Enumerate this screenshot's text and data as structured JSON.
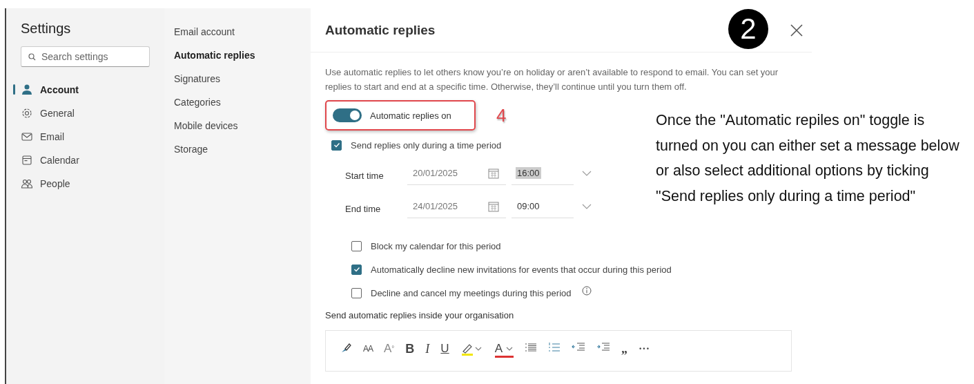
{
  "settings": {
    "title": "Settings",
    "search": {
      "placeholder": "Search settings"
    },
    "nav": [
      {
        "label": "Account",
        "selected": true
      },
      {
        "label": "General",
        "selected": false
      },
      {
        "label": "Email",
        "selected": false
      },
      {
        "label": "Calendar",
        "selected": false
      },
      {
        "label": "People",
        "selected": false
      }
    ]
  },
  "submenu": [
    {
      "label": "Email account",
      "selected": false
    },
    {
      "label": "Automatic replies",
      "selected": true
    },
    {
      "label": "Signatures",
      "selected": false
    },
    {
      "label": "Categories",
      "selected": false
    },
    {
      "label": "Mobile devices",
      "selected": false
    },
    {
      "label": "Storage",
      "selected": false
    }
  ],
  "panel": {
    "title": "Automatic replies",
    "step_badge": "2",
    "description": "Use automatic replies to let others know you’re on holiday or aren’t available to respond to email. You can set your replies to start and end at a specific time. Otherwise, they’ll continue until you turn them off.",
    "toggle": {
      "label": "Automatic replies on",
      "on": true,
      "callout": "4"
    },
    "time_period": {
      "label": "Send replies only during a time period",
      "checked": true
    },
    "times": [
      {
        "label": "Start time",
        "date": "20/01/2025",
        "time": "16:00",
        "selected": true
      },
      {
        "label": "End time",
        "date": "24/01/2025",
        "time": "09:00",
        "selected": false
      }
    ],
    "options": [
      {
        "label": "Block my calendar for this period",
        "checked": false,
        "info": false
      },
      {
        "label": "Automatically decline new invitations for events that occur during this period",
        "checked": true,
        "info": false
      },
      {
        "label": "Decline and cancel my meetings during this period",
        "checked": false,
        "info": true
      }
    ],
    "inside_heading": "Send automatic replies inside your organisation",
    "toolbar": [
      {
        "kind": "brush"
      },
      {
        "kind": "font-size",
        "text": "AA"
      },
      {
        "kind": "clear-format",
        "text": "A",
        "mark": "°"
      },
      {
        "kind": "bold",
        "text": "B"
      },
      {
        "kind": "italic",
        "text": "I"
      },
      {
        "kind": "underline",
        "text": "U"
      },
      {
        "kind": "highlight"
      },
      {
        "kind": "font-color",
        "text": "A"
      },
      {
        "kind": "bullets"
      },
      {
        "kind": "numbering"
      },
      {
        "kind": "outdent"
      },
      {
        "kind": "indent"
      },
      {
        "kind": "quote",
        "text": "„"
      },
      {
        "kind": "more",
        "text": "···"
      }
    ]
  },
  "annotation": "Once the \"Automatic repiles on\" toggle is turned on you can either set a message below or also select additional options by ticking \"Send replies only during a time period\""
}
